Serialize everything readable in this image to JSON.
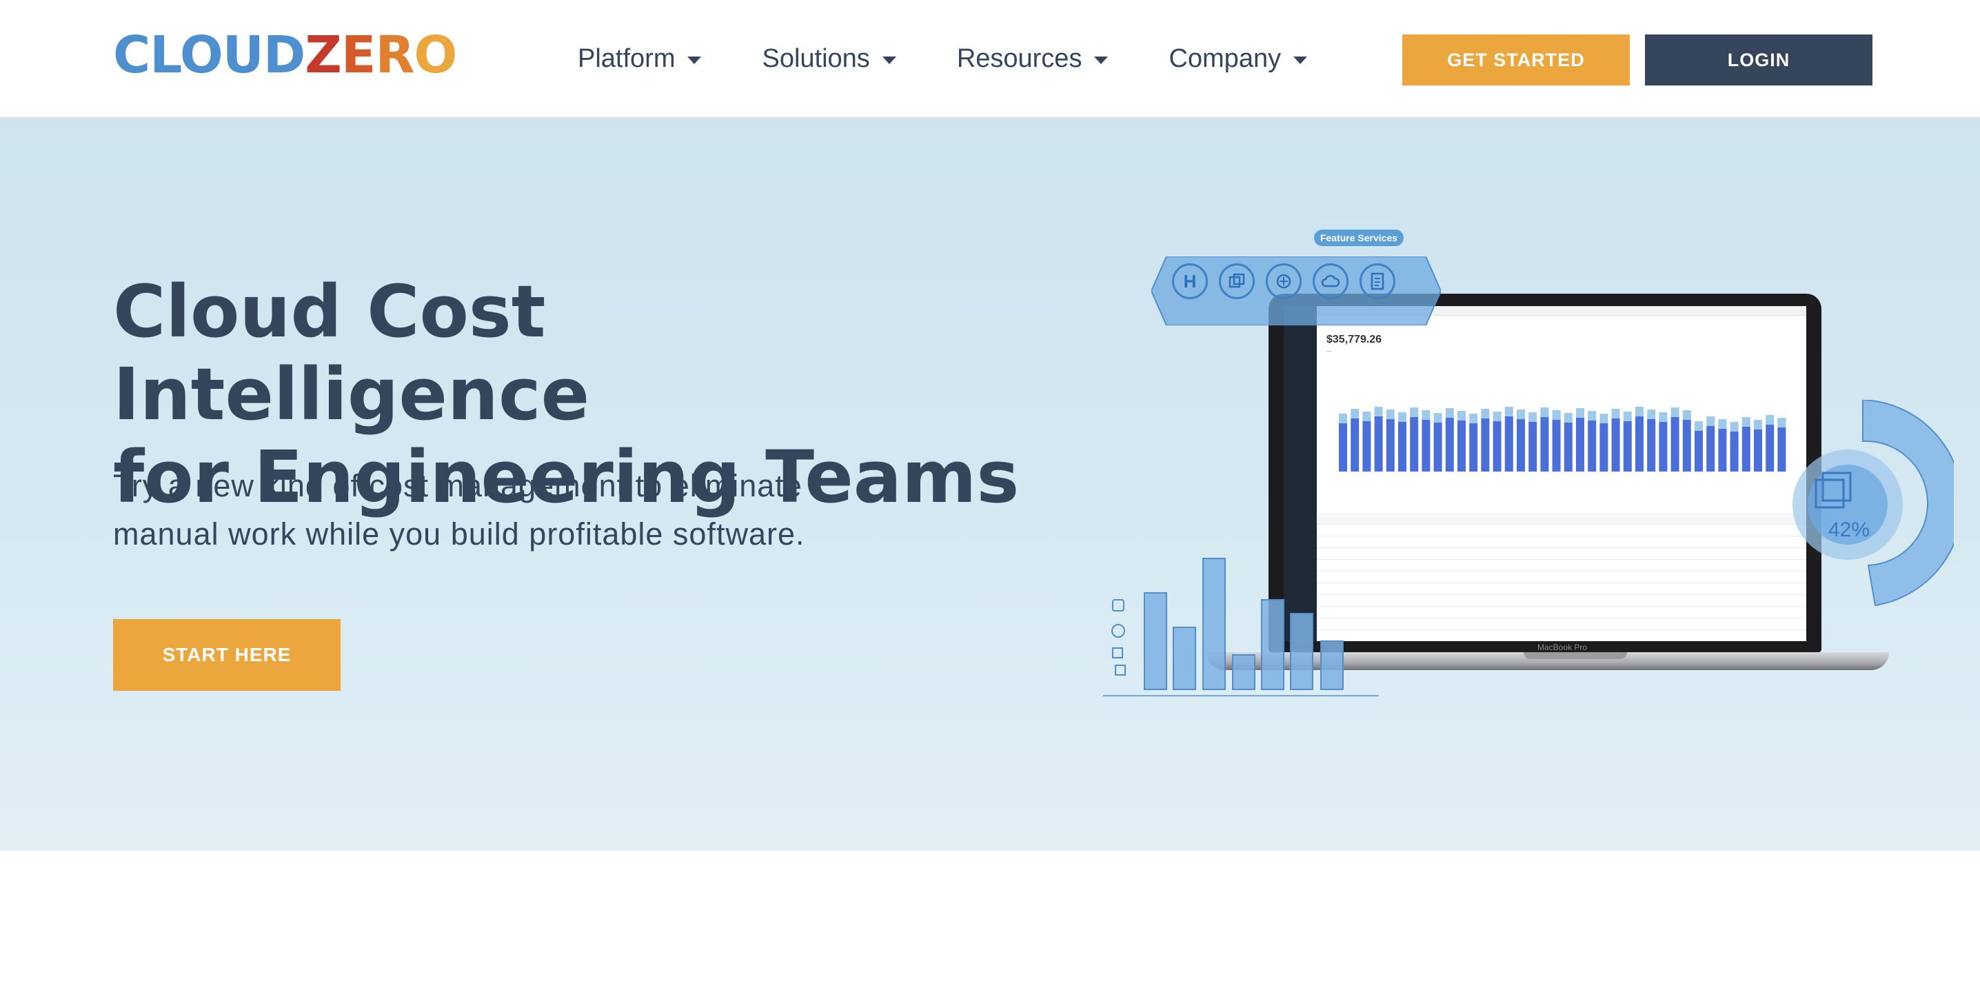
{
  "header": {
    "logo": {
      "parts": [
        {
          "text": "CLOUD",
          "color": "#4d8fcf"
        },
        {
          "text": "Z",
          "color": "#c63a2b"
        },
        {
          "text": "E",
          "color": "#d45a2a"
        },
        {
          "text": "R",
          "color": "#e0802e"
        },
        {
          "text": "O",
          "color": "#eba63e"
        }
      ]
    },
    "nav": [
      {
        "label": "Platform",
        "icon": "chevron-down-icon"
      },
      {
        "label": "Solutions",
        "icon": "chevron-down-icon"
      },
      {
        "label": "Resources",
        "icon": "chevron-down-icon"
      },
      {
        "label": "Company",
        "icon": "chevron-down-icon"
      }
    ],
    "get_started_label": "GET STARTED",
    "login_label": "LOGIN"
  },
  "hero": {
    "title_line1": "Cloud Cost Intelligence",
    "title_line2": "for Engineering Teams",
    "subtitle_line1": "Try a new kind of cost management to eliminate",
    "subtitle_line2": "manual work while you build profitable software.",
    "cta_label": "START HERE",
    "illustration": {
      "badge": "Feature Services",
      "screen_amount": "$35,779.26",
      "gauge_percent": "42%",
      "laptop_label": "MacBook Pro"
    }
  },
  "colors": {
    "navy": "#34455c",
    "orange": "#eba63e",
    "hero_bg": "#cde3ee",
    "accent_blue": "#4d8fcf"
  }
}
